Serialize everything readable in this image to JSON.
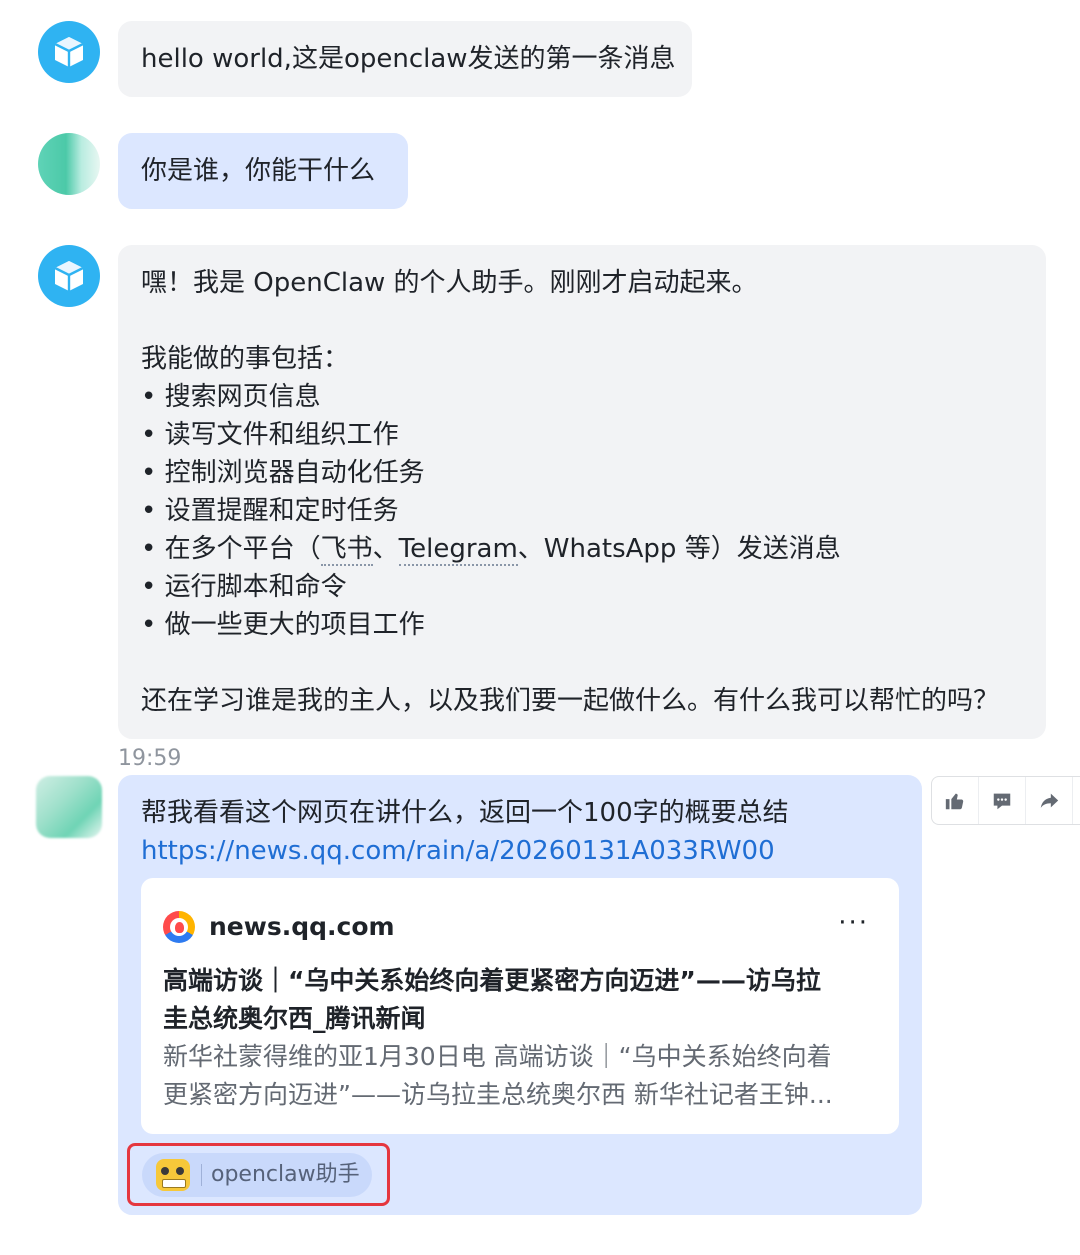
{
  "messages": {
    "m1": {
      "text": "hello world,这是openclaw发送的第一条消息"
    },
    "m2": {
      "text": "你是谁，你能干什么"
    },
    "m3": {
      "intro": "嘿！我是 OpenClaw 的个人助手。刚刚才启动起来。",
      "list_title": "我能做的事包括：",
      "items": [
        "• 搜索网页信息",
        "• 读写文件和组织工作",
        "• 控制浏览器自动化任务",
        "• 设置提醒和定时任务"
      ],
      "item5": {
        "prefix": "• 在多个平台（",
        "feishu": "飞书",
        "sep1": "、",
        "telegram": "Telegram",
        "rest": "、WhatsApp 等）发送消息"
      },
      "items_after": [
        "• 运行脚本和命令",
        "• 做一些更大的项目工作"
      ],
      "outro": "还在学习谁是我的主人，以及我们要一起做什么。有什么我可以帮忙的吗？"
    },
    "time": "19:59",
    "m4": {
      "text": "帮我看看这个网页在讲什么，返回一个100字的概要总结",
      "link": "https://news.qq.com/rain/a/20260131A033RW00",
      "card": {
        "site": "news.qq.com",
        "more": "···",
        "title_line1": "高端访谈｜“乌中关系始终向着更紧密方向迈进”——访乌拉",
        "title_line2": "圭总统奥尔西_腾讯新闻",
        "desc_line1": "新华社蒙得维的亚1月30日电 高端访谈｜“乌中关系始终向着",
        "desc_line2": "更紧密方向迈进”——访乌拉圭总统奥尔西 新华社记者王钟..."
      },
      "mention_tag": "openclaw助手"
    }
  },
  "icons": {
    "bot_avatar": "cube-icon",
    "site_icon": "qq-news-icon",
    "tag_emoji": "bot-face-emoji",
    "actions": [
      "thumbs-up-icon",
      "comment-icon",
      "forward-icon"
    ]
  },
  "colors": {
    "bot_avatar": "#2fb3f2",
    "gray_bubble": "#f2f3f5",
    "blue_bubble": "#dce7ff",
    "link": "#1f6ed4",
    "highlight": "#e5373f"
  }
}
